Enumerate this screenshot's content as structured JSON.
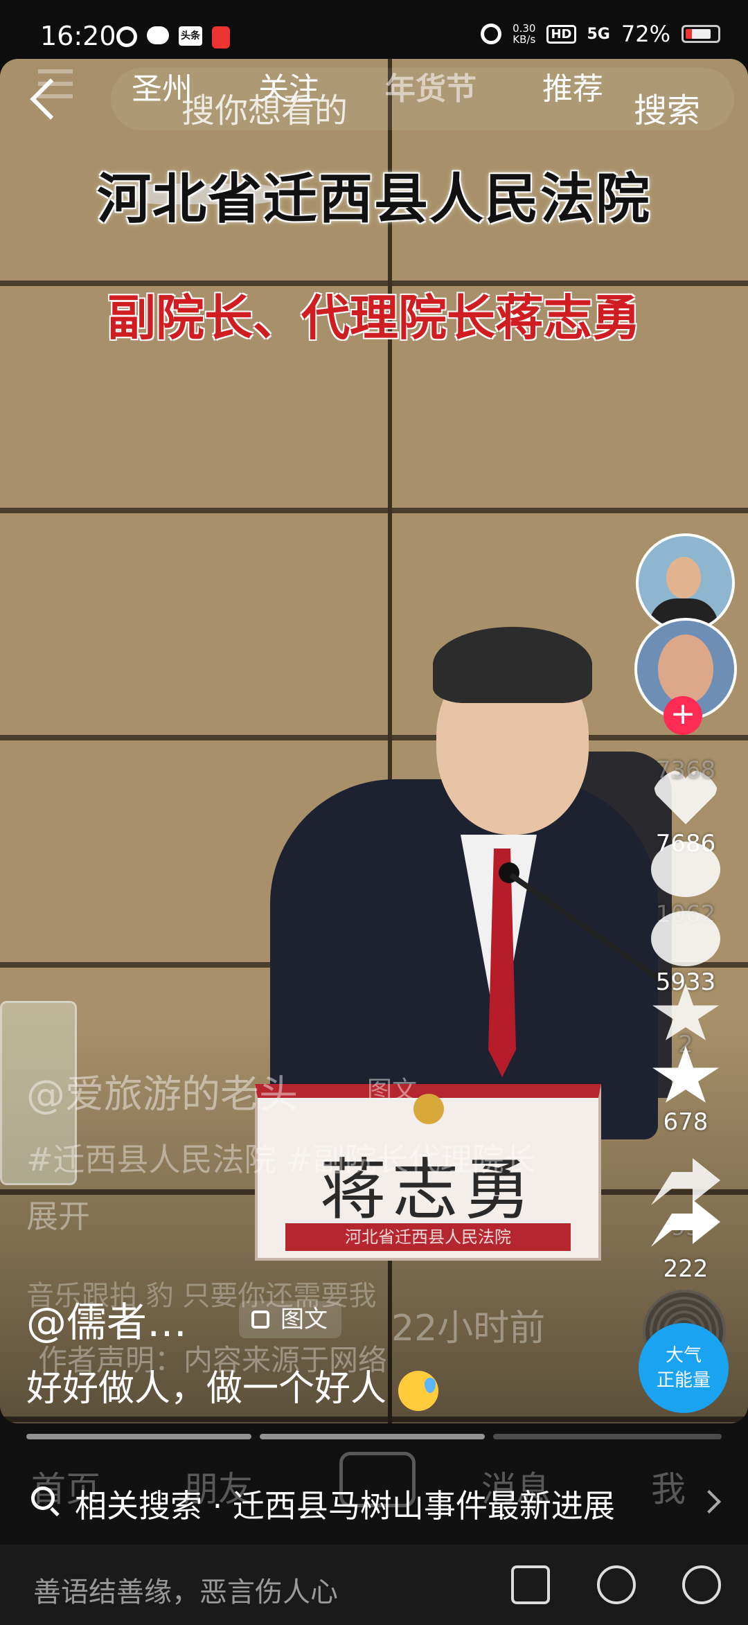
{
  "status": {
    "time": "16:20",
    "net_speed": "0.30",
    "net_unit": "KB/s",
    "hd": "HD",
    "signal": "5G",
    "battery": "72%",
    "notif_box_label": "头条"
  },
  "ghost_tabs": [
    "圣州",
    "关注",
    "年货节",
    "推荐"
  ],
  "search": {
    "placeholder": "搜你想看的",
    "button": "搜索"
  },
  "video": {
    "title": "河北省迁西县人民法院",
    "subtitle": "副院长、代理院长蒋志勇",
    "nameplate_name": "蒋志勇",
    "nameplate_sub": "河北省迁西县人民法院"
  },
  "side": {
    "ghost_like_count": "7368",
    "like_count": "7686",
    "ghost_comment_count": "1062",
    "comment_count": "5933",
    "ghost_fav_count": "2",
    "fav_count": "678",
    "ghost_share_count": "93",
    "share_count": "222",
    "badge_line1": "大气",
    "badge_line2": "正能量"
  },
  "ghost_post": {
    "author": "@爱旅游的老头",
    "chip": "图文",
    "tags": "#迁西县人民法院 #副院长代理院长",
    "expand": "展开",
    "music": "音乐跟拍  豹    只要你还需要我",
    "time": "22小时前",
    "declaration": "作者声明：内容来源于网络"
  },
  "post": {
    "author": "@儒者…",
    "chip": "图文",
    "caption": "好好做人，做一个好人"
  },
  "ghost_nav": [
    "首页",
    "朋友",
    "消息",
    "我"
  ],
  "related": {
    "text": "相关搜索 · 迁西县马树山事件最新进展"
  },
  "comment_bar": {
    "placeholder": "善语结善缘，恶言伤人心"
  },
  "colors": {
    "accent": "#fe2c55",
    "badge": "#1aa3f0",
    "subtitle_red": "#d01d22"
  },
  "icons": [
    "back-icon",
    "heart-icon",
    "comment-icon",
    "star-icon",
    "share-icon",
    "search-icon",
    "image-icon",
    "at-icon",
    "emoji-icon"
  ]
}
